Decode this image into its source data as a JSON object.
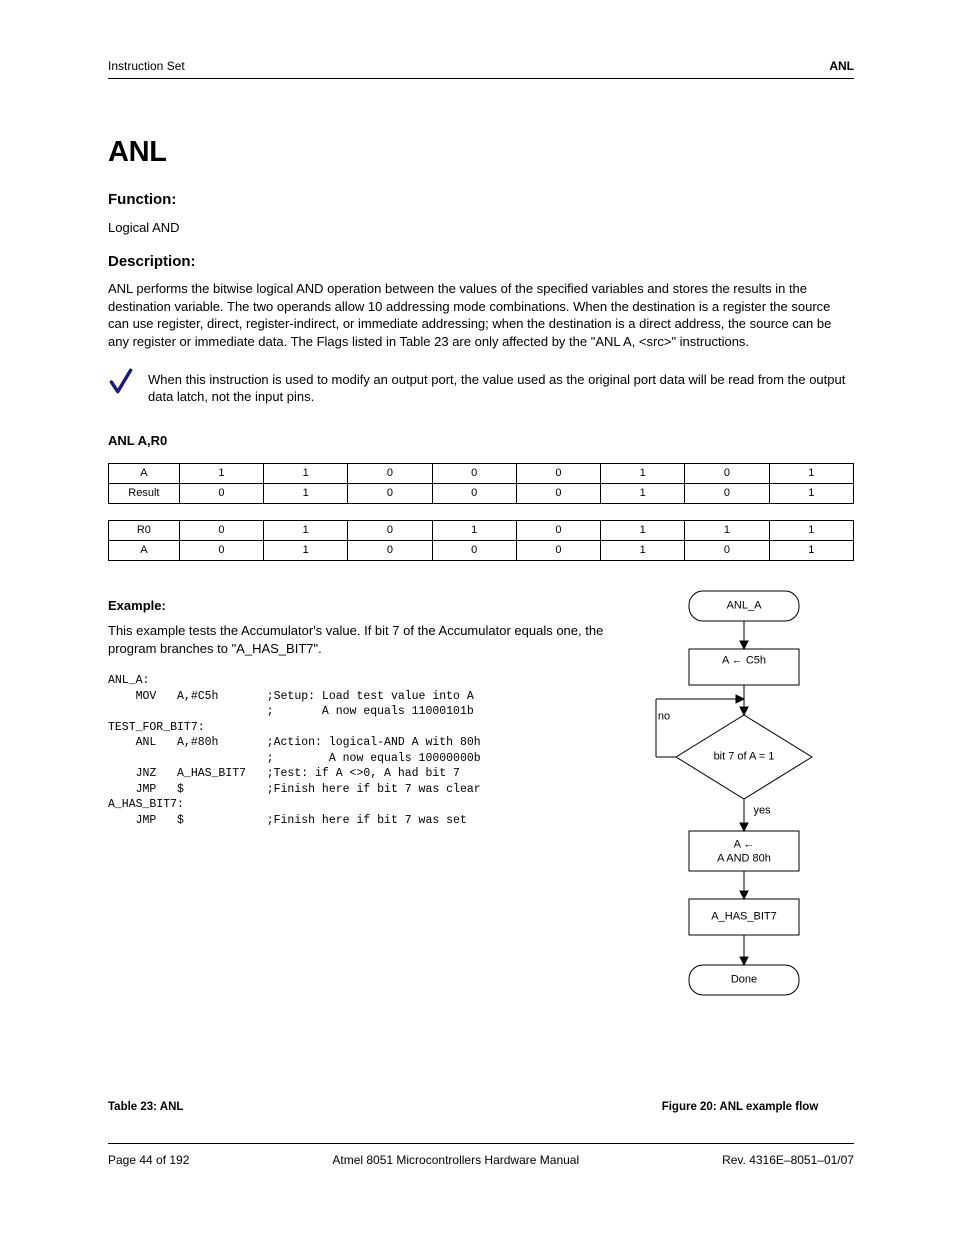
{
  "header": {
    "left": "Instruction Set",
    "right": "ANL"
  },
  "title": "ANL",
  "function": {
    "heading": "Function:",
    "text": "Logical AND"
  },
  "description": {
    "heading": "Description:",
    "text_before_table": "ANL performs the bitwise logical AND operation between the values of the specified variables and stores the results in the destination variable.  The two operands allow 10 addressing mode combinations.  When the destination is a register the source can use register, direct, register-indirect, or immediate addressing; when the destination is a direct address, the source can be any register or immediate data. The Flags listed in Table 23 are only affected by the \"ANL  A, <src>\" instructions.",
    "note": "When this instruction is used to modify an output port, the value used as the original port data will be read from the output data latch, not the input pins.",
    "table1_label": "ANL  A,R0",
    "table1_rowA": [
      "A",
      "1",
      "1",
      "0",
      "0",
      "0",
      "1",
      "0",
      "1"
    ],
    "table1_rowB": [
      "Result",
      "0",
      "1",
      "0",
      "0",
      "0",
      "1",
      "0",
      "1"
    ],
    "table2_rowA": [
      "R0",
      "0",
      "1",
      "0",
      "1",
      "0",
      "1",
      "1",
      "1"
    ],
    "table2_rowB": [
      "A",
      "0",
      "1",
      "0",
      "0",
      "0",
      "1",
      "0",
      "1"
    ]
  },
  "example": {
    "heading": "Example:",
    "text": "This example tests the Accumulator's value.  If bit 7 of the Accumulator equals one, the program branches to \"A_HAS_BIT7\"."
  },
  "code": [
    "ANL_A:",
    "    MOV   A,#C5h       ;Setup: Load test value into A",
    "                       ;       A now equals 11000101b",
    "TEST_FOR_BIT7:",
    "    ANL   A,#80h       ;Action: logical-AND A with 80h",
    "                       ;        A now equals 10000000b",
    "    JNZ   A_HAS_BIT7   ;Test: if A <>0, A had bit 7",
    "    JMP   $            ;Finish here if bit 7 was clear",
    "A_HAS_BIT7:",
    "    JMP   $            ;Finish here if bit 7 was set"
  ],
  "flow": {
    "start": "ANL_A",
    "step1_a": "A",
    "step1_b": "C5h",
    "cond": "bit 7 of A = 1",
    "no": "no",
    "yes": "yes",
    "step2_a": "A",
    "step2_b": "A AND 80h",
    "step3": "A_HAS_BIT7",
    "done": "Done",
    "arrow": "←",
    "arrow2": "←"
  },
  "caption_table": "Table 23: ANL",
  "caption_fig": "Figure 20: ANL example flow",
  "footer": {
    "left": "Page 44 of 192",
    "mid": "Atmel 8051 Microcontrollers Hardware Manual",
    "right": "Rev. 4316E–8051–01/07"
  }
}
